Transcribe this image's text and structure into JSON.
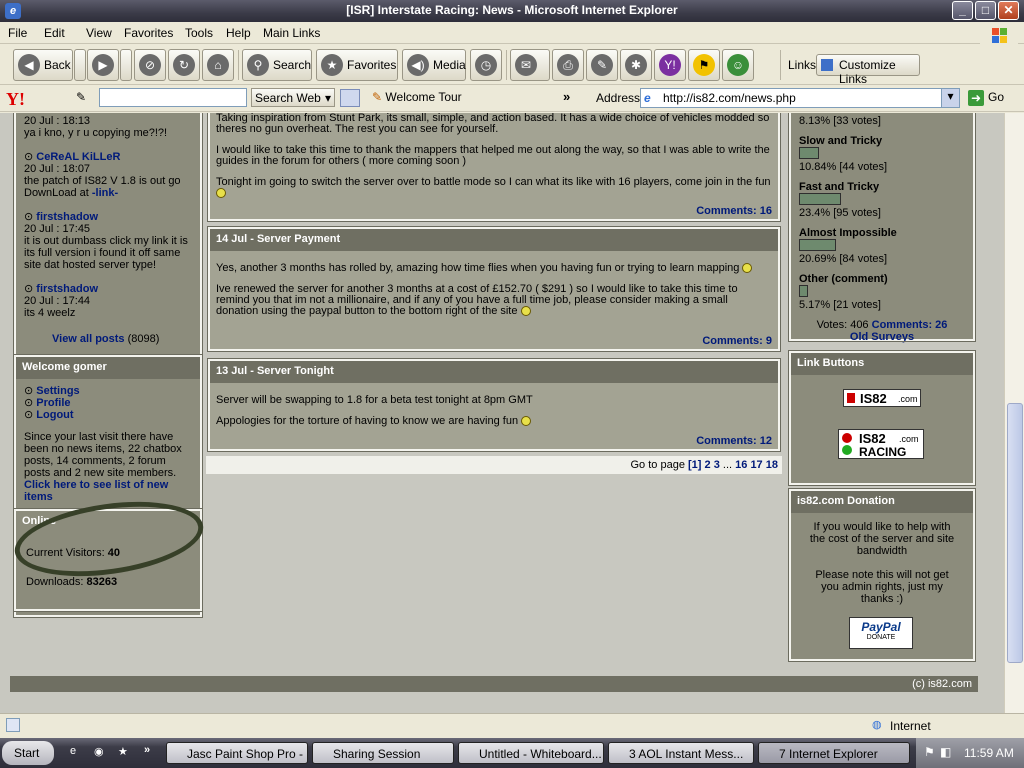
{
  "window": {
    "title": "[ISR] Interstate Racing: News - Microsoft Internet Explorer",
    "minimize": "_",
    "maximize": "□",
    "close": "✕"
  },
  "menu": [
    "File",
    "Edit",
    "View",
    "Favorites",
    "Tools",
    "Help",
    "Main Links"
  ],
  "toolbar": {
    "back": "Back",
    "search": "Search",
    "favorites": "Favorites",
    "media": "Media",
    "links_label": "Links",
    "customize_links": "Customize Links"
  },
  "addressbar": {
    "yahoo": "Y!",
    "search_web": "Search Web",
    "welcome_tour": "Welcome Tour",
    "address_label": "Address",
    "url": "http://is82.com/news.php",
    "go": "Go",
    "chevron": "»"
  },
  "chatbox": [
    {
      "time": "20 Jul : 18:13",
      "text": "ya i kno, y r u copying me?!?!"
    },
    {
      "user": "CeReAL KiLLeR",
      "time": "20 Jul : 18:07",
      "text": "the patch of IS82 V 1.8 is out go DownLoad at",
      "link": "-link-"
    },
    {
      "user": "firstshadow",
      "time": "20 Jul : 17:45",
      "text": "it is out dumbass click my link it is its full version i found it off same site dat hosted server type!"
    },
    {
      "user": "firstshadow",
      "time": "20 Jul : 17:44",
      "text": "its 4 weelz"
    }
  ],
  "chatbox_footer": {
    "label": "View all posts",
    "count": "(8098)"
  },
  "welcome": {
    "title": "Welcome gomer",
    "links": [
      "Settings",
      "Profile",
      "Logout"
    ],
    "message": "Since your last visit there have been no news items, 22 chatbox posts, 14 comments, 2 forum posts and 2 new site members.",
    "newitems": "Click here to see list of new items"
  },
  "online": {
    "title": "Online",
    "visitors_label": "Current Visitors:",
    "visitors_value": "40",
    "downloads_label": "Downloads:",
    "downloads_value": "83263"
  },
  "news": [
    {
      "title": "",
      "p1": "Taking inspiration from Stunt Park, its small, simple, and action based. It has a wide choice of vehicles modded so theres no gun overheat. The rest you can see for yourself.",
      "p2": "I would like to take this time to thank the mappers that helped me out along the way, so that I was able to write the guides in the forum for others ( more coming soon )",
      "p3": "Tonight im going to switch the server over to battle mode so I can what its like with 16 players, come join in the fun",
      "comments": "Comments: 16"
    },
    {
      "title": "14 Jul - Server Payment",
      "p1": "Yes, another 3 months has rolled by, amazing how time flies when you having fun or trying to learn mapping",
      "p2": "Ive renewed the server for another 3 months at a cost of £152.70 ( $291 ) so I would like to take this time to remind you that im not a millionaire, and if any of you have a full time job, please consider making a small donation using the paypal button to the bottom right of the site",
      "comments": "Comments: 9"
    },
    {
      "title": "13 Jul - Server Tonight",
      "p1": "Server will be swapping to 1.8 for a beta test tonight at 8pm GMT",
      "p2": "Appologies for the torture of having to know we are having fun",
      "comments": "Comments: 12"
    }
  ],
  "pagination": {
    "label": "Go to page",
    "current": "[1]",
    "p2": "2",
    "p3": "3",
    "ellipsis": "...",
    "p16": "16",
    "p17": "17",
    "p18": "18"
  },
  "survey": {
    "first": {
      "result": "8.13% [33 votes]"
    },
    "options": [
      {
        "label": "Slow and Tricky",
        "result": "10.84% [44 votes]",
        "fraction": 0.1084
      },
      {
        "label": "Fast and Tricky",
        "result": "23.4% [95 votes]",
        "fraction": 0.234
      },
      {
        "label": "Almost Impossible",
        "result": "20.69% [84 votes]",
        "fraction": 0.2069
      },
      {
        "label": "Other (comment)",
        "result": "5.17% [21 votes]",
        "fraction": 0.0517
      }
    ],
    "votes": "Votes: 406",
    "comments": "Comments: 26",
    "old": "Old Surveys"
  },
  "linkbuttons": {
    "title": "Link Buttons",
    "b1": "IS82",
    "b1_sub": ".com",
    "b2": "IS82",
    "b2_sub": ".com",
    "b2_racing": "RACING"
  },
  "donation": {
    "title": "is82.com Donation",
    "p1": "If you would like to help with the cost of the server and site bandwidth",
    "p2": "Please note this will not get you admin rights, just my thanks :)",
    "paypal": "PayPal",
    "donate": "DONATE"
  },
  "footer": "(c) is82.com",
  "statusbar": {
    "zone": "Internet"
  },
  "taskbar": {
    "start": "Start",
    "overflow": "»",
    "tasks": [
      "Jasc Paint Shop Pro - ...",
      "Sharing Session",
      "Untitled - Whiteboard...",
      "3  AOL Instant Mess...",
      "7 Internet Explorer"
    ],
    "clock": "11:59 AM"
  }
}
